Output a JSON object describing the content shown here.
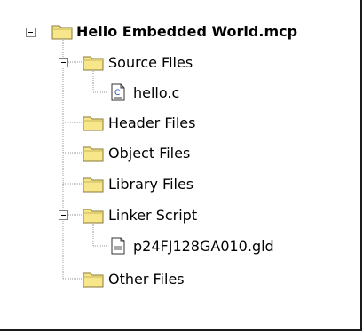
{
  "tree": {
    "root": {
      "label": "Hello Embedded World.mcp",
      "icon": "folder-icon",
      "expanded": true
    },
    "folders": [
      {
        "label": "Source Files",
        "icon": "folder-icon",
        "expanded": true,
        "children": [
          {
            "label": "hello.c",
            "icon": "c-source-file-icon"
          }
        ]
      },
      {
        "label": "Header Files",
        "icon": "folder-icon"
      },
      {
        "label": "Object Files",
        "icon": "folder-icon"
      },
      {
        "label": "Library Files",
        "icon": "folder-icon"
      },
      {
        "label": "Linker Script",
        "icon": "folder-icon",
        "expanded": true,
        "children": [
          {
            "label": "p24FJ128GA010.gld",
            "icon": "text-file-icon"
          }
        ]
      },
      {
        "label": "Other Files",
        "icon": "folder-icon"
      }
    ]
  },
  "colors": {
    "folder_fill": "#f7e78a",
    "folder_outline": "#8a7a3a",
    "tree_lines": "#9a9a9a"
  }
}
